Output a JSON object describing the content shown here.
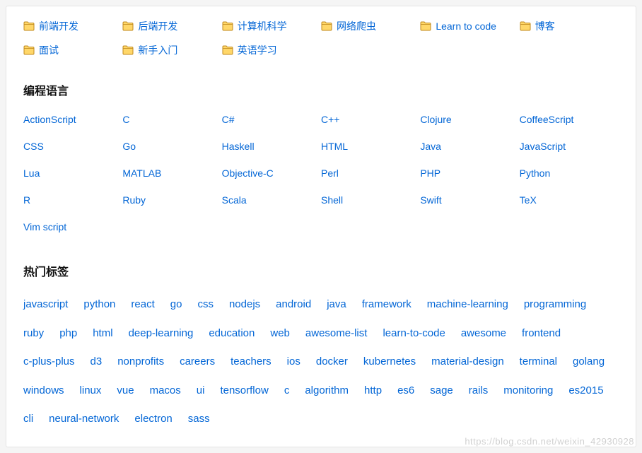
{
  "folders": [
    {
      "label": "前端开发"
    },
    {
      "label": "后端开发"
    },
    {
      "label": "计算机科学"
    },
    {
      "label": "网络爬虫"
    },
    {
      "label": "Learn to code"
    },
    {
      "label": "博客"
    },
    {
      "label": "面试"
    },
    {
      "label": "新手入门"
    },
    {
      "label": "英语学习"
    }
  ],
  "sections": {
    "languages_title": "编程语言",
    "tags_title": "热门标签"
  },
  "languages": [
    "ActionScript",
    "C",
    "C#",
    "C++",
    "Clojure",
    "CoffeeScript",
    "CSS",
    "Go",
    "Haskell",
    "HTML",
    "Java",
    "JavaScript",
    "Lua",
    "MATLAB",
    "Objective-C",
    "Perl",
    "PHP",
    "Python",
    "R",
    "Ruby",
    "Scala",
    "Shell",
    "Swift",
    "TeX",
    "Vim script"
  ],
  "tags": [
    "javascript",
    "python",
    "react",
    "go",
    "css",
    "nodejs",
    "android",
    "java",
    "framework",
    "machine-learning",
    "programming",
    "ruby",
    "php",
    "html",
    "deep-learning",
    "education",
    "web",
    "awesome-list",
    "learn-to-code",
    "awesome",
    "frontend",
    "c-plus-plus",
    "d3",
    "nonprofits",
    "careers",
    "teachers",
    "ios",
    "docker",
    "kubernetes",
    "material-design",
    "terminal",
    "golang",
    "windows",
    "linux",
    "vue",
    "macos",
    "ui",
    "tensorflow",
    "c",
    "algorithm",
    "http",
    "es6",
    "sage",
    "rails",
    "monitoring",
    "es2015",
    "cli",
    "neural-network",
    "electron",
    "sass"
  ],
  "watermark": "https://blog.csdn.net/weixin_42930928"
}
